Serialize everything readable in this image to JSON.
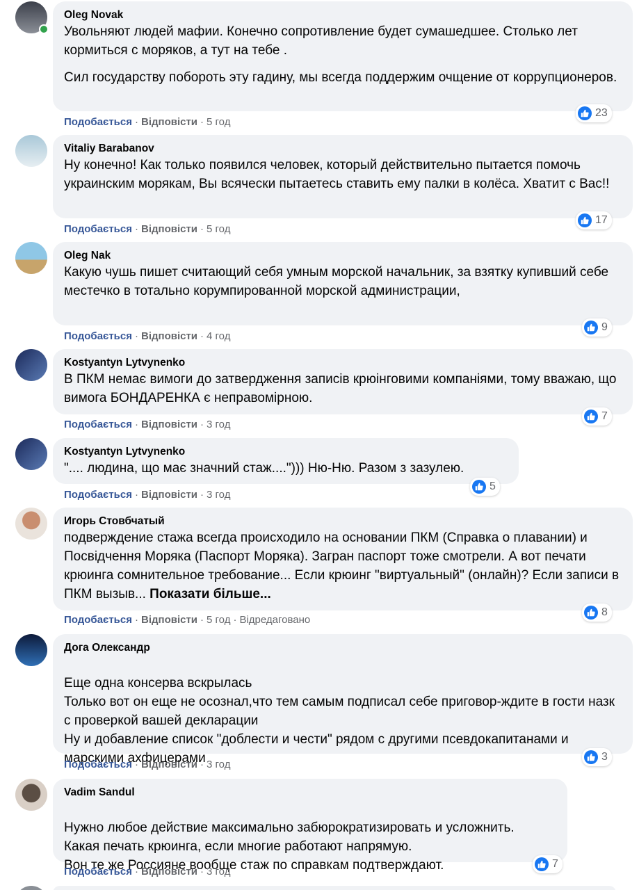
{
  "actions": {
    "like": "Подобається",
    "reply": "Відповісти",
    "separator": "·"
  },
  "comments": [
    {
      "author": "Oleg Novak",
      "paragraphs": [
        "Увольняют людей мафии. Конечно сопротивление будет сумашедшее. Столько лет кормиться с моряков, а тут на тебе .",
        "Сил государству побороть эту гадину, мы всегда поддержим очщение от коррупционеров."
      ],
      "time": "5 год",
      "reactions": "23",
      "online": true,
      "avatar_colors": [
        "#3b3f4a",
        "#8b8f97"
      ]
    },
    {
      "author": "Vitaliy Barabanov",
      "paragraphs": [
        "Ну конечно! Как только появился человек, который действительно пытается помочь украинским морякам, Вы всячески пытаетесь ставить ему палки в колёса. Хватит с Вас!!"
      ],
      "time": "5 год",
      "reactions": "17",
      "avatar_colors": [
        "#a9c8d8",
        "#e6eef2"
      ]
    },
    {
      "author": "Oleg Nak",
      "paragraphs": [
        "Какую чушь пишет считающий себя умным морской начальник, за взятку купивший себе местечко в тотально корумпированной морской администрации,"
      ],
      "time": "4 год",
      "reactions": "9",
      "avatar_colors": [
        "#8fc7e6",
        "#c7a46b"
      ]
    },
    {
      "author": "Kostyantyn Lytvynenko",
      "paragraphs": [
        "В ПКМ немає вимоги до затвердження записів крюінговими компаніями, тому вважаю, що вимога БОНДАРЕНКА є неправомірною."
      ],
      "time": "3 год",
      "reactions": "7",
      "avatar_colors": [
        "#1c2a5a",
        "#5a7bb5"
      ]
    },
    {
      "author": "Kostyantyn Lytvynenko",
      "paragraphs": [
        "\".... людина, що має значний стаж....\"))) Ню-Ню. Разом з зазулею."
      ],
      "time": "3 год",
      "reactions": "5",
      "avatar_colors": [
        "#1c2a5a",
        "#5a7bb5"
      ]
    },
    {
      "author": "Игорь Стовбчатый",
      "paragraphs": [
        "подверждение стажа всегда происходило на основании ПКМ (Справка о плавании) и Посвідчення Моряка (Паспорт Моряка). Загран паспорт тоже смотрели. А вот печати крюинга сомнительное требование... Если крюинг \"виртуальный\" (онлайн)? Если записи в ПКМ вызыв... "
      ],
      "see_more": "Показати більше...",
      "time": "5 год",
      "edited": "Відредаговано",
      "reactions": "8",
      "avatar_colors": [
        "#c98e6f",
        "#eae3dc"
      ]
    },
    {
      "author": "Дога Олександр",
      "paragraphs": [
        "Еще одна консерва вскрылась\nТолько вот он еще не осознал,что тем самым подписал себе приговор-ждите в гости назк с проверкой вашей декларации\nНу и добавление список \"доблести и чести\" рядом с другими псевдокапитанами и марскими ахфицерами"
      ],
      "time": "3 год",
      "reactions": "3",
      "avatar_colors": [
        "#0d1a3a",
        "#2f6fb5"
      ]
    },
    {
      "author": "Vadim Sandul",
      "paragraphs": [
        "Нужно любое действие максимально забюрократизировать и усложнить.\nКакая печать крюинга, если многие работают напрямую.\nВон те же Россияне вообще стаж по справкам подтверждают."
      ],
      "time": "3 год",
      "reactions": "7",
      "avatar_colors": [
        "#5b4e44",
        "#d9cfc6"
      ]
    }
  ]
}
